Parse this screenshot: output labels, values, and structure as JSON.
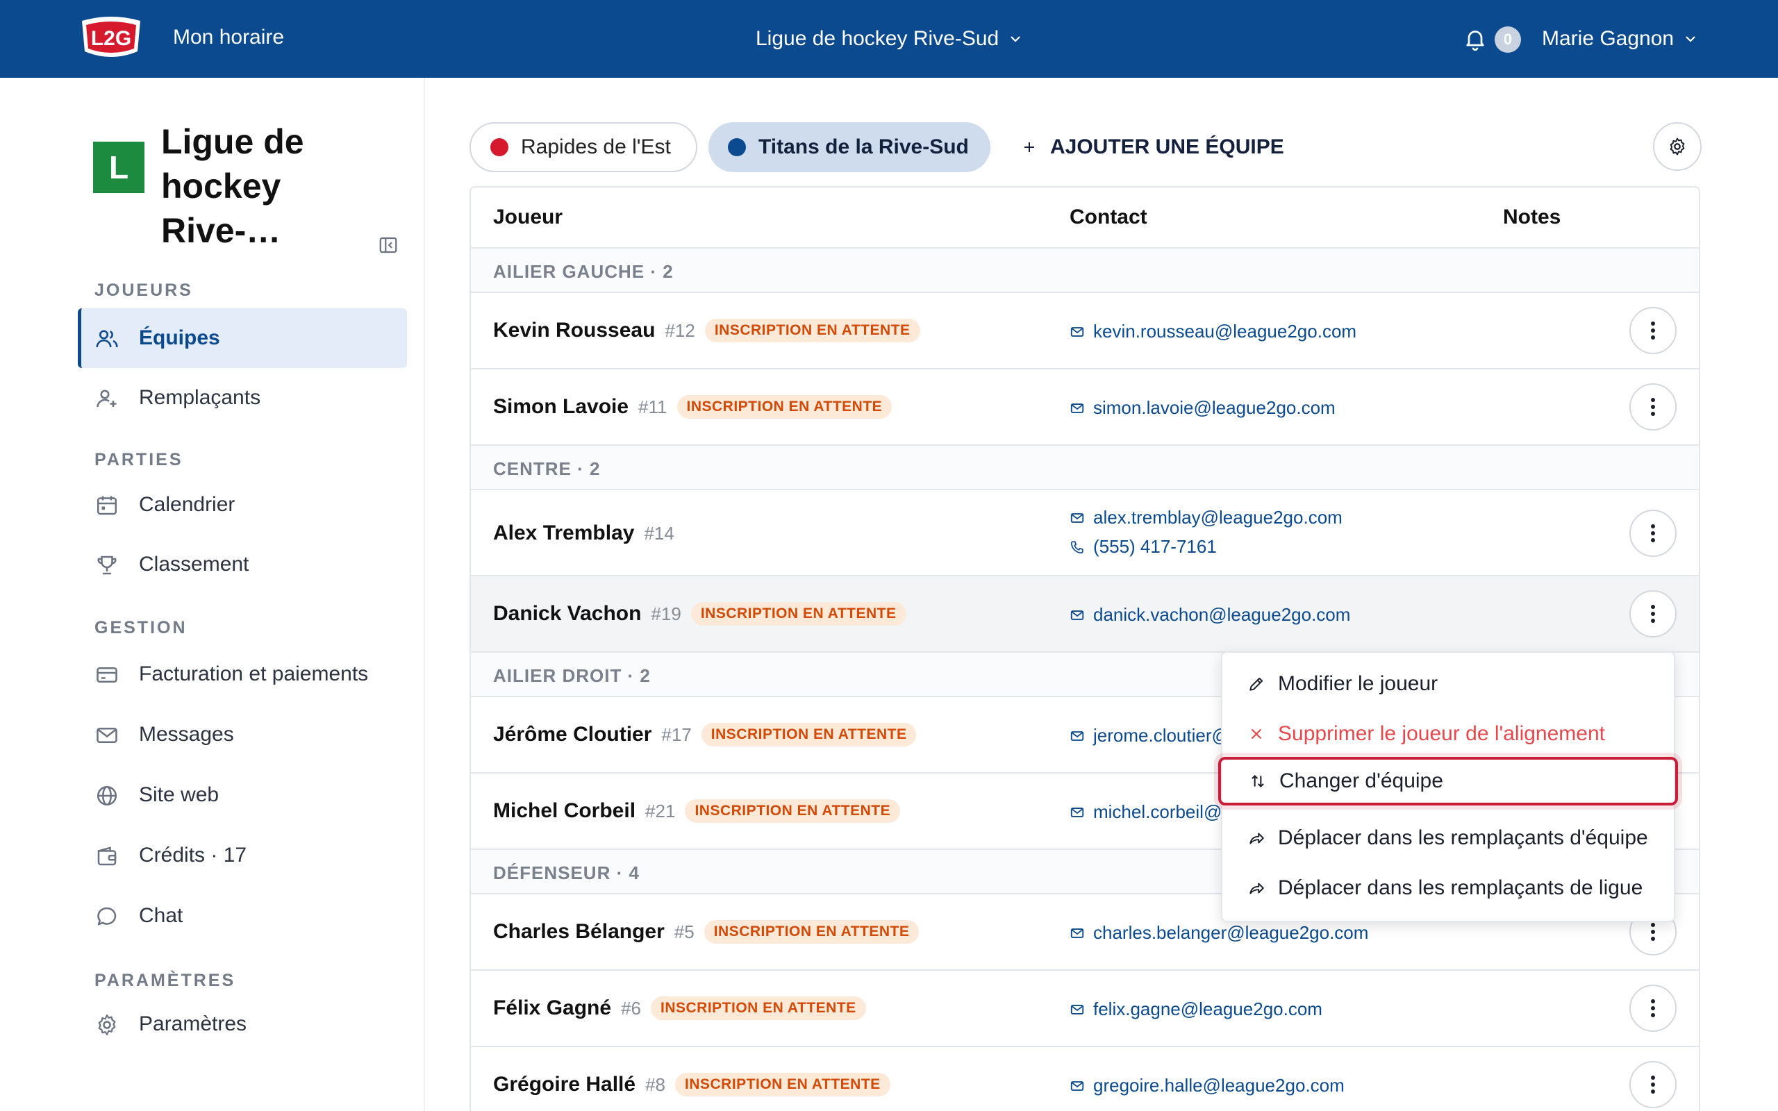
{
  "topbar": {
    "logo_text": "L2G",
    "nav_title": "Mon horaire",
    "league_switch": "Ligue de hockey Rive-Sud",
    "notifications_count": "0",
    "user_name": "Marie Gagnon"
  },
  "sidebar": {
    "org_initial": "L",
    "org_name": "Ligue de hockey Rive-…",
    "sections": {
      "joueurs": "JOUEURS",
      "parties": "PARTIES",
      "gestion": "GESTION",
      "parametres": "PARAMÈTRES"
    },
    "items": {
      "equipes": "Équipes",
      "remplacants": "Remplaçants",
      "calendrier": "Calendrier",
      "classement": "Classement",
      "facturation": "Facturation et paiements",
      "messages": "Messages",
      "site_web": "Site web",
      "credits": "Crédits · 17",
      "chat": "Chat",
      "parametres": "Paramètres"
    }
  },
  "main": {
    "tabs": [
      {
        "label": "Rapides de l'Est",
        "color": "#d7192d"
      },
      {
        "label": "Titans de la Rive-Sud",
        "color": "#0b4a8f"
      }
    ],
    "add_team": "AJOUTER UNE ÉQUIPE",
    "columns": {
      "player": "Joueur",
      "contact": "Contact",
      "notes": "Notes"
    },
    "groups": {
      "ailier_gauche": "AILIER GAUCHE · 2",
      "centre": "CENTRE · 2",
      "ailier_droit": "AILIER DROIT · 2",
      "defenseur": "DÉFENSEUR · 4"
    },
    "pending_badge": "INSCRIPTION EN ATTENTE",
    "players": [
      {
        "name": "Kevin Rousseau",
        "number": "#12",
        "email": "kevin.rousseau@league2go.com"
      },
      {
        "name": "Simon Lavoie",
        "number": "#11",
        "email": "simon.lavoie@league2go.com"
      },
      {
        "name": "Alex Tremblay",
        "number": "#14",
        "email": "alex.tremblay@league2go.com",
        "phone": "(555) 417-7161"
      },
      {
        "name": "Danick Vachon",
        "number": "#19",
        "email": "danick.vachon@league2go.com"
      },
      {
        "name": "Jérôme Cloutier",
        "number": "#17",
        "email": "jerome.cloutier@"
      },
      {
        "name": "Michel Corbeil",
        "number": "#21",
        "email": "michel.corbeil@"
      },
      {
        "name": "Charles Bélanger",
        "number": "#5",
        "email": "charles.belanger@league2go.com"
      },
      {
        "name": "Félix Gagné",
        "number": "#6",
        "email": "felix.gagne@league2go.com"
      },
      {
        "name": "Grégoire Hallé",
        "number": "#8",
        "email": "gregoire.halle@league2go.com"
      }
    ]
  },
  "menu": {
    "edit": "Modifier le joueur",
    "remove": "Supprimer le joueur de l'alignement",
    "change_team": "Changer d'équipe",
    "move_team_subs": "Déplacer dans les remplaçants d'équipe",
    "move_league_subs": "Déplacer dans les remplaçants de ligue"
  },
  "colors": {
    "brand": "#0b4a8f",
    "badge_text": "#d24a06",
    "badge_bg": "#fde9d7",
    "danger": "#e5484d",
    "focus_ring": "#c81e3a"
  }
}
